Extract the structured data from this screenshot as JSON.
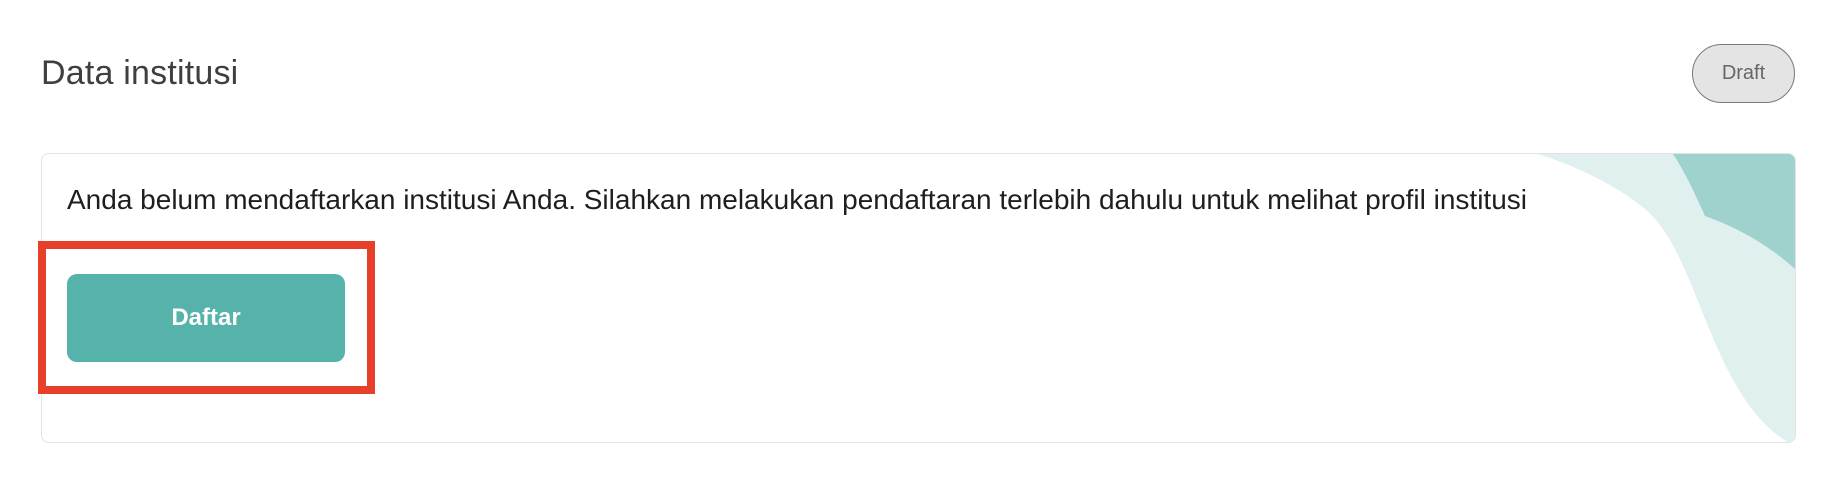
{
  "header": {
    "title": "Data institusi",
    "status": "Draft"
  },
  "card": {
    "message": "Anda belum mendaftarkan institusi Anda. Silahkan melakukan pendaftaran terlebih dahulu untuk melihat profil institusi",
    "button_label": "Daftar"
  },
  "colors": {
    "accent": "#55b3ab",
    "accent_light": "#e0f0ee",
    "accent_mid": "#9fd2cd",
    "highlight": "#e6402b",
    "badge_bg": "#e4e4e4"
  }
}
